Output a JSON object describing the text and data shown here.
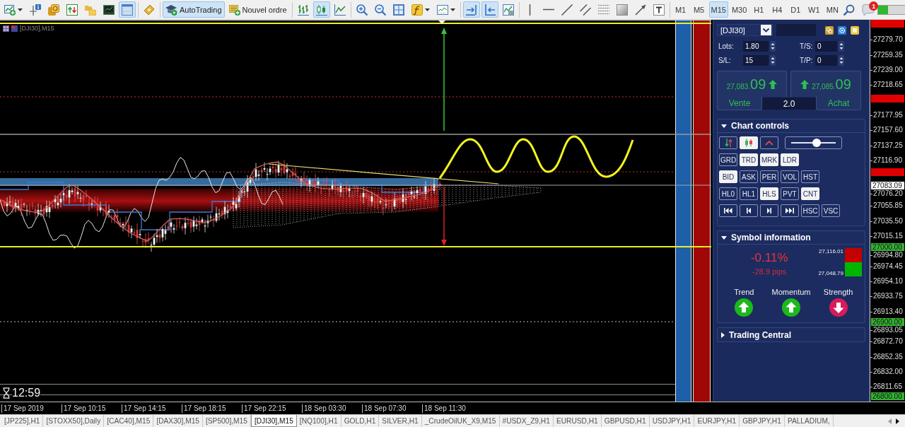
{
  "toolbar": {
    "groups": [
      [
        {
          "selected": false
        },
        {
          "selected": false
        },
        {
          "selected": false
        },
        {
          "selected": false
        },
        {
          "selected": false
        },
        {
          "selected": false
        },
        {
          "selected": true
        }
      ],
      [
        {
          "selected": false
        }
      ],
      [
        {
          "label": "AutoTrading",
          "selected": true
        },
        {
          "label": "Nouvel ordre",
          "selected": false
        }
      ],
      [
        {
          "selected": false
        },
        {
          "selected": true
        },
        {
          "selected": false
        }
      ],
      [
        {
          "selected": false
        },
        {
          "selected": false
        },
        {
          "selected": false
        },
        {
          "selected": false
        },
        {
          "selected": false
        }
      ],
      [
        {
          "selected": true
        },
        {
          "selected": true
        },
        {
          "selected": false
        }
      ],
      [
        {
          "selected": false
        },
        {
          "selected": false
        },
        {
          "selected": false
        },
        {
          "selected": false
        },
        {
          "selected": false
        },
        {
          "selected": false
        },
        {
          "selected": false
        },
        {
          "selected": false
        }
      ],
      [
        {
          "label": "M1",
          "selected": false
        },
        {
          "label": "M5",
          "selected": false
        },
        {
          "label": "M15",
          "selected": true
        },
        {
          "label": "M30",
          "selected": false
        },
        {
          "label": "H1",
          "selected": false
        },
        {
          "label": "H4",
          "selected": false
        },
        {
          "label": "D1",
          "selected": false
        },
        {
          "label": "W1",
          "selected": false
        },
        {
          "label": "MN",
          "selected": false
        }
      ],
      [
        {
          "selected": false
        },
        {
          "badge": "1",
          "selected": false
        }
      ]
    ]
  },
  "chart": {
    "title": "[DJI30],M15",
    "timer": "12:59",
    "price_labels": [
      "27279.70",
      "27259.35",
      "27239.00",
      "27218.65",
      "27177.95",
      "27157.60",
      "27137.25",
      "27116.90",
      "27076.20",
      "27055.85",
      "27035.50",
      "27015.15",
      "26994.80",
      "26974.45",
      "26954.10",
      "26933.75",
      "26913.40",
      "26893.05",
      "26872.70",
      "26852.35",
      "26832.00",
      "26811.65"
    ],
    "price_tags": [
      {
        "color": "#e00000"
      },
      {
        "color": "#e00000"
      },
      {
        "color": "#e00000"
      },
      {
        "label": "27083.09",
        "color": "#ffffff"
      },
      {
        "label": "27000.00",
        "color": "#34b334"
      },
      {
        "label": "26900.00",
        "color": "#34b334"
      },
      {
        "label": "26800.00",
        "color": "#34b334"
      }
    ],
    "time_labels": [
      "17 Sep 2019",
      "17 Sep 10:15",
      "17 Sep 14:15",
      "17 Sep 18:15",
      "17 Sep 22:15",
      "18 Sep 03:30",
      "18 Sep 07:30",
      "18 Sep 11:30"
    ]
  },
  "panel": {
    "symbol": "[DJI30]",
    "fields": [
      {
        "label": "Lots:",
        "value": "1.80"
      },
      {
        "label": "T/S:",
        "value": "0"
      },
      {
        "label": "S/L:",
        "value": "15"
      },
      {
        "label": "T/P:",
        "value": "0"
      }
    ],
    "sell": {
      "price": "27,083.",
      "pips": "09",
      "label": "Vente"
    },
    "buy": {
      "price": "27,085.",
      "pips": "09",
      "label": "Achat"
    },
    "volume": "2.0",
    "sections": [
      {
        "kind": "controls",
        "title": "Chart controls",
        "expanded": true,
        "rows": [
          [
            {
              "kind": "icon",
              "selected": false
            },
            {
              "kind": "icon",
              "selected": true
            },
            {
              "kind": "icon",
              "selected": false
            },
            {
              "kind": "slider",
              "level": 0.57
            }
          ],
          [
            {
              "kind": "text",
              "label": "GRD",
              "selected": false
            },
            {
              "kind": "text",
              "label": "TRD",
              "selected": true
            },
            {
              "kind": "text",
              "label": "MRK",
              "selected": true
            },
            {
              "kind": "text",
              "label": "LDR",
              "selected": true
            }
          ],
          [
            {
              "kind": "text",
              "label": "BID",
              "selected": true
            },
            {
              "kind": "text",
              "label": "ASK",
              "selected": false
            },
            {
              "kind": "text",
              "label": "PER",
              "selected": false
            },
            {
              "kind": "text",
              "label": "VOL",
              "selected": false
            },
            {
              "kind": "text",
              "label": "HST",
              "selected": false
            }
          ],
          [
            {
              "kind": "text",
              "label": "HL0",
              "selected": false
            },
            {
              "kind": "text",
              "label": "HL1",
              "selected": false
            },
            {
              "kind": "text",
              "label": "HLS",
              "selected": true
            },
            {
              "kind": "text",
              "label": "PVT",
              "selected": false
            },
            {
              "kind": "text",
              "label": "CNT",
              "selected": true
            }
          ],
          [
            {
              "kind": "icon",
              "selected": false
            },
            {
              "kind": "icon",
              "selected": false
            },
            {
              "kind": "icon",
              "selected": false
            },
            {
              "kind": "icon",
              "selected": false
            },
            {
              "kind": "text",
              "label": "HSC",
              "selected": false
            },
            {
              "kind": "text",
              "label": "VSC",
              "selected": false
            }
          ]
        ]
      },
      {
        "kind": "info",
        "title": "Symbol information",
        "expanded": true,
        "change": "-0.11%",
        "pips": "-28.9 pips",
        "high": "27,116.01",
        "low": "27,048.79",
        "signals": [
          {
            "label": "Trend",
            "rising": true
          },
          {
            "label": "Momentum",
            "rising": true
          },
          {
            "label": "Strength",
            "rising": false
          }
        ]
      },
      {
        "title": "Trading Central",
        "expanded": false
      }
    ]
  },
  "tabs": [
    {
      "label": "[JP225],H1",
      "selected": false
    },
    {
      "label": "[STOXX50],Daily",
      "selected": false
    },
    {
      "label": "[CAC40],M15",
      "selected": false
    },
    {
      "label": "[DAX30],M15",
      "selected": false
    },
    {
      "label": "[SP500],M15",
      "selected": false
    },
    {
      "label": "[DJI30],M15",
      "selected": true
    },
    {
      "label": "[NQ100],H1",
      "selected": false
    },
    {
      "label": "GOLD,H1",
      "selected": false
    },
    {
      "label": "SILVER,H1",
      "selected": false
    },
    {
      "label": "_CrudeOilUK_X9,M15",
      "selected": false
    },
    {
      "label": "#USDX_Z9,H1",
      "selected": false
    },
    {
      "label": "EURUSD,H1",
      "selected": false
    },
    {
      "label": "GBPUSD,H1",
      "selected": false
    },
    {
      "label": "USDJPY,H1",
      "selected": false
    },
    {
      "label": "EURJPY,H1",
      "selected": false
    },
    {
      "label": "GBPJPY,H1",
      "selected": false
    },
    {
      "label": "PALLADIUM,",
      "selected": false
    }
  ]
}
